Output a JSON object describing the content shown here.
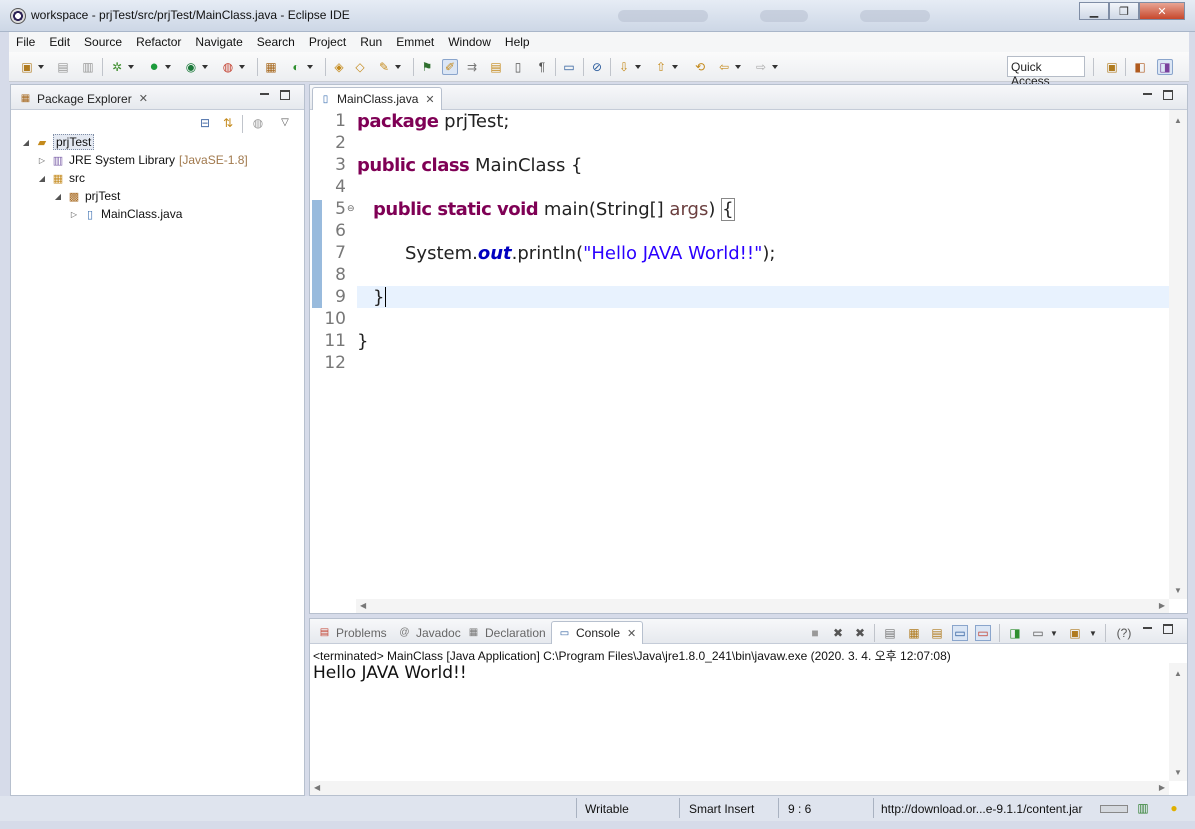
{
  "window": {
    "title": "workspace - prjTest/src/prjTest/MainClass.java - Eclipse IDE"
  },
  "menu": [
    "File",
    "Edit",
    "Source",
    "Refactor",
    "Navigate",
    "Search",
    "Project",
    "Run",
    "Emmet",
    "Window",
    "Help"
  ],
  "toolbar": {
    "quick_access": "Quick Access"
  },
  "package_explorer": {
    "tab_label": "Package Explorer",
    "tree": [
      {
        "label": "prjTest",
        "icon": "project-folder-icon",
        "decor": ""
      },
      {
        "label": "JRE System Library",
        "icon": "library-icon",
        "decor": "[JavaSE-1.8]"
      },
      {
        "label": "src",
        "icon": "source-folder-icon",
        "decor": ""
      },
      {
        "label": "prjTest",
        "icon": "package-icon",
        "decor": ""
      },
      {
        "label": "MainClass.java",
        "icon": "java-file-icon",
        "decor": ""
      }
    ]
  },
  "editor": {
    "tab_label": "MainClass.java",
    "line_numbers": [
      "1",
      "2",
      "3",
      "4",
      "5",
      "6",
      "7",
      "8",
      "9",
      "10",
      "11",
      "12"
    ],
    "code": {
      "l1_kw": "package",
      "l1_rest": " prjTest;",
      "l3_kw": "public class",
      "l3_rest": " MainClass {",
      "l5_kw": "public static void",
      "l5_name": " main",
      "l5_args_open": "(String[] ",
      "l5_param": "args",
      "l5_close": ") ",
      "l5_brace": "{",
      "l7_obj": "System.",
      "l7_field": "out",
      "l7_method": ".println(",
      "l7_str": "\"Hello JAVA World!!\"",
      "l7_end": ");",
      "l9": "}",
      "l11": "}"
    }
  },
  "console": {
    "tabs": [
      "Problems",
      "Javadoc",
      "Declaration",
      "Console"
    ],
    "header": "<terminated> MainClass [Java Application] C:\\Program Files\\Java\\jre1.8.0_241\\bin\\javaw.exe (2020. 3. 4. 오후 12:07:08)",
    "output": "Hello JAVA World!!"
  },
  "statusbar": {
    "writable": "Writable",
    "insert_mode": "Smart Insert",
    "position": "9 : 6",
    "download": "http://download.or...e-9.1.1/content.jar"
  },
  "colors": {
    "keyword": "#7f0055",
    "string": "#2a00ff",
    "field": "#0000c0",
    "current_line": "#e8f2fe"
  }
}
